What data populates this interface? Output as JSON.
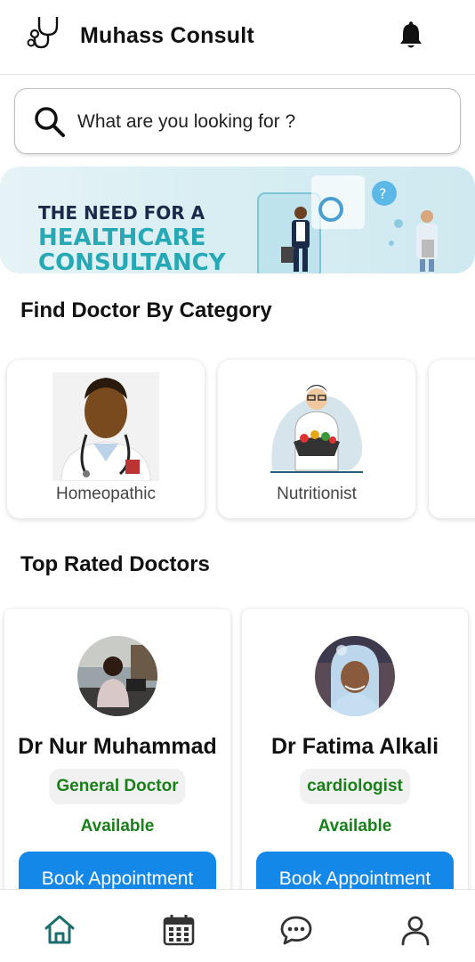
{
  "header": {
    "title": "Muhass Consult",
    "logo_icon": "stethoscope-icon",
    "notification_icon": "bell-icon"
  },
  "search": {
    "placeholder": "What are you looking for ?",
    "value": "",
    "icon": "search-icon"
  },
  "banner": {
    "line1": "THE NEED FOR A",
    "line2": "HEALTHCARE",
    "line3": "CONSULTANCY"
  },
  "categories": {
    "title": "Find Doctor By Category",
    "items": [
      {
        "label": "Homeopathic"
      },
      {
        "label": "Nutritionist"
      }
    ]
  },
  "top_rated": {
    "title": "Top Rated Doctors",
    "doctors": [
      {
        "name": "Dr Nur Muhammad",
        "specialty": "General Doctor",
        "status": "Available",
        "button": "Book Appointment"
      },
      {
        "name": "Dr Fatima Alkali",
        "specialty": "cardiologist",
        "status": "Available",
        "button": "Book Appointment"
      }
    ]
  },
  "bottom_nav": {
    "items": [
      {
        "icon": "home-icon",
        "active": true
      },
      {
        "icon": "calendar-icon",
        "active": false
      },
      {
        "icon": "chat-icon",
        "active": false
      },
      {
        "icon": "profile-icon",
        "active": false
      }
    ]
  },
  "colors": {
    "accent": "#1488e8",
    "status_green": "#1a7f1a",
    "active_nav": "#1c6e6e"
  }
}
